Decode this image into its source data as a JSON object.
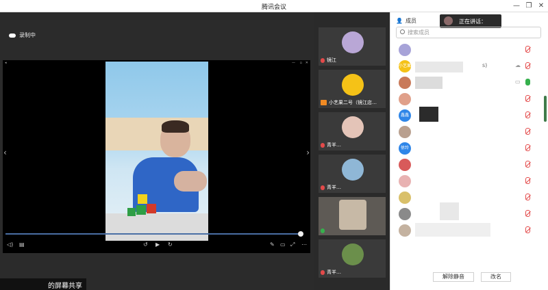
{
  "window": {
    "title": "腾讯会议",
    "controls": [
      "—",
      "❐",
      "✕"
    ]
  },
  "main": {
    "recording_label": "录制中",
    "share_label": "的屏幕共享",
    "player_controls": [
      "◀",
      "↺",
      "▶",
      "↻",
      "✎",
      "▭",
      "⤢",
      "⋯"
    ]
  },
  "thumbnails": [
    {
      "name": "镜江",
      "avatar_color": "#b9a7d6",
      "mic": "red"
    },
    {
      "name": "小艺果二号（镜江店…",
      "avatar_color": "#f5c217",
      "mic": "none"
    },
    {
      "name": "青羊…",
      "avatar_color": "#e4c4b8",
      "mic": "red"
    },
    {
      "name": "青羊…",
      "avatar_color": "#8fb7d6",
      "mic": "red"
    },
    {
      "name": "",
      "avatar_color": "#c7b9a6",
      "mic": "green"
    },
    {
      "name": "青羊…",
      "avatar_color": "#6b8f4b",
      "mic": "red"
    }
  ],
  "members_panel": {
    "header": "成员",
    "speaking_label": "正在讲话：",
    "search_placeholder": "搜索成员",
    "members": [
      {
        "avatar_text": "",
        "avatar_color": "#a7a3d8",
        "name": "",
        "mic": "off"
      },
      {
        "avatar_text": "小艺果",
        "avatar_color": "#f5c217",
        "name": "s)",
        "mic": "off"
      },
      {
        "avatar_text": "",
        "avatar_color": "#c97a5a",
        "name": "",
        "mic": "on"
      },
      {
        "avatar_text": "",
        "avatar_color": "#e0a08a",
        "name": "",
        "mic": "off"
      },
      {
        "avatar_text": "鑫鑫",
        "avatar_color": "#2f86e8",
        "name": "",
        "mic": "off"
      },
      {
        "avatar_text": "",
        "avatar_color": "#b9a08f",
        "name": "",
        "mic": "off"
      },
      {
        "avatar_text": "徐玲",
        "avatar_color": "#2f86e8",
        "name": "",
        "mic": "off"
      },
      {
        "avatar_text": "",
        "avatar_color": "#d85a5a",
        "name": "",
        "mic": "off"
      },
      {
        "avatar_text": "",
        "avatar_color": "#e8b2b2",
        "name": "",
        "mic": "off"
      },
      {
        "avatar_text": "",
        "avatar_color": "#d9c06a",
        "name": "",
        "mic": "off"
      },
      {
        "avatar_text": "",
        "avatar_color": "#8a8a8a",
        "name": "",
        "mic": "off"
      },
      {
        "avatar_text": "",
        "avatar_color": "#c4b2a0",
        "name": "",
        "mic": "off"
      }
    ],
    "unmute_all_button": "解除静音",
    "rename_button": "改名"
  }
}
